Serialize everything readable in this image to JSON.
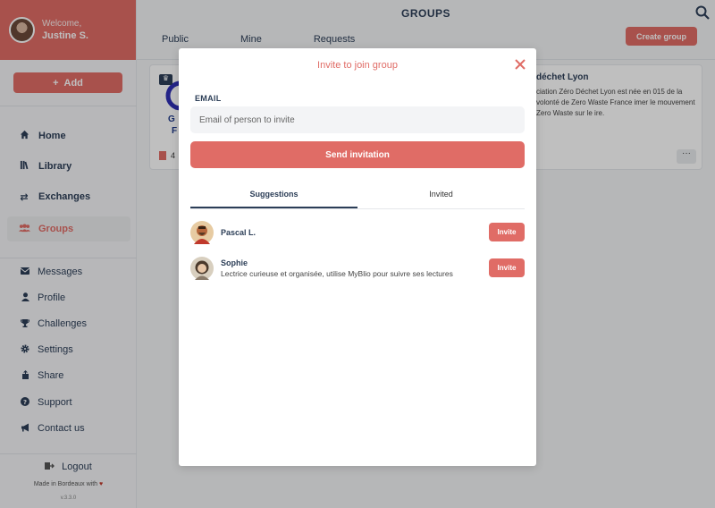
{
  "user": {
    "welcome": "Welcome,",
    "name": "Justine S."
  },
  "sidebar": {
    "add_label": "Add",
    "nav": [
      {
        "label": "Home",
        "icon": "home-icon"
      },
      {
        "label": "Library",
        "icon": "library-icon"
      },
      {
        "label": "Exchanges",
        "icon": "exchange-icon"
      },
      {
        "label": "Groups",
        "icon": "groups-icon"
      }
    ],
    "links": [
      {
        "label": "Messages",
        "icon": "mail-icon"
      },
      {
        "label": "Profile",
        "icon": "user-icon"
      },
      {
        "label": "Challenges",
        "icon": "trophy-icon"
      },
      {
        "label": "Settings",
        "icon": "gear-icon"
      },
      {
        "label": "Share",
        "icon": "share-icon"
      },
      {
        "label": "Support",
        "icon": "help-icon"
      },
      {
        "label": "Contact us",
        "icon": "megaphone-icon"
      }
    ],
    "logout": "Logout",
    "made_in": "Made in Bordeaux with",
    "version": "v.3.3.0"
  },
  "header": {
    "title": "GROUPS",
    "tabs": [
      "Public",
      "Mine",
      "Requests"
    ],
    "create_label": "Create group"
  },
  "group_card": {
    "logo_text_1": "G",
    "logo_text_2": "F",
    "books_count": "4",
    "title": "déchet Lyon",
    "description": "ciation Zéro Déchet Lyon est née en 015 de la volonté de Zero Waste France imer le mouvement Zero Waste sur le ire."
  },
  "modal": {
    "title": "Invite to join group",
    "email_label": "EMAIL",
    "email_placeholder": "Email of person to invite",
    "send_label": "Send invitation",
    "tabs": [
      "Suggestions",
      "Invited"
    ],
    "suggestions": [
      {
        "name": "Pascal L.",
        "desc": "",
        "invite_label": "Invite"
      },
      {
        "name": "Sophie",
        "desc": "Lectrice curieuse et organisée, utilise MyBlio pour suivre ses lectures",
        "invite_label": "Invite"
      }
    ]
  },
  "colors": {
    "accent": "#e06c66",
    "navy": "#2c3e57"
  }
}
